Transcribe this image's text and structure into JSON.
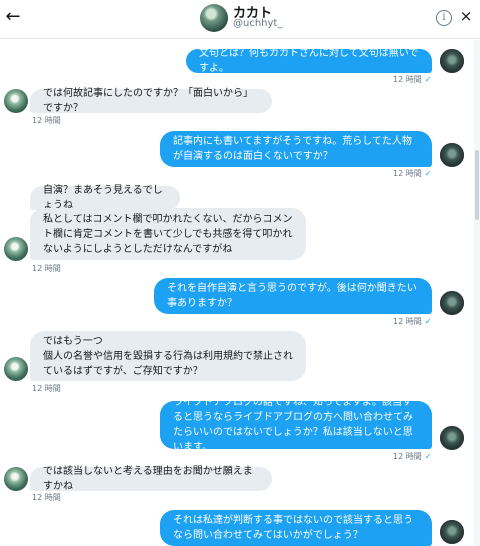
{
  "header": {
    "name": "カカト",
    "handle": "@uchhyt_",
    "back_icon": "←",
    "info_icon": "i",
    "close_icon": "×"
  },
  "messages": [
    {
      "side": "out",
      "text": "文句とは？何もカカトさんに対して文句は無いですよ。",
      "time": "12 時間",
      "read": "✓"
    },
    {
      "side": "in",
      "text": "では何故記事にしたのですか？「面白いから」ですか？",
      "time": "12 時間"
    },
    {
      "side": "out",
      "text": "記事内にも書いてますがそうですね。荒らしてた人物が自演するのは面白くないですか？",
      "time": "12 時間",
      "read": "✓"
    },
    {
      "side": "in",
      "text": "自演？まあそう見えるでしょうね",
      "time": ""
    },
    {
      "side": "in",
      "text": "私としてはコメント欄で叩かれたくない、だからコメント欄に肯定コメントを書いて少しでも共感を得て叩かれないようにしようとしただけなんですがね",
      "time": "12 時間"
    },
    {
      "side": "out",
      "text": "それを自作自演と言う思うのですが。後は何か聞きたい事ありますか？",
      "time": "12 時間",
      "read": "✓"
    },
    {
      "side": "in",
      "text": "ではもう一つ\n個人の名誉や信用を毀損する行為は利用規約で禁止されているはずですが、ご存知ですか？",
      "time": "12 時間"
    },
    {
      "side": "out",
      "text": "ライブドアブログの話ですね、知ってますよ。該当すると思うならライブドアブログの方へ問い合わせてみたらいいのではないでしょうか？私は該当しないと思います。",
      "time": "12 時間",
      "read": "✓"
    },
    {
      "side": "in",
      "text": "では該当しないと考える理由をお聞かせ願えますかね",
      "time": "12 時間"
    },
    {
      "side": "out",
      "text": "それは私達が判断する事ではないので該当すると思うなら問い合わせてみてはいかがでしょう？",
      "time": ""
    }
  ]
}
